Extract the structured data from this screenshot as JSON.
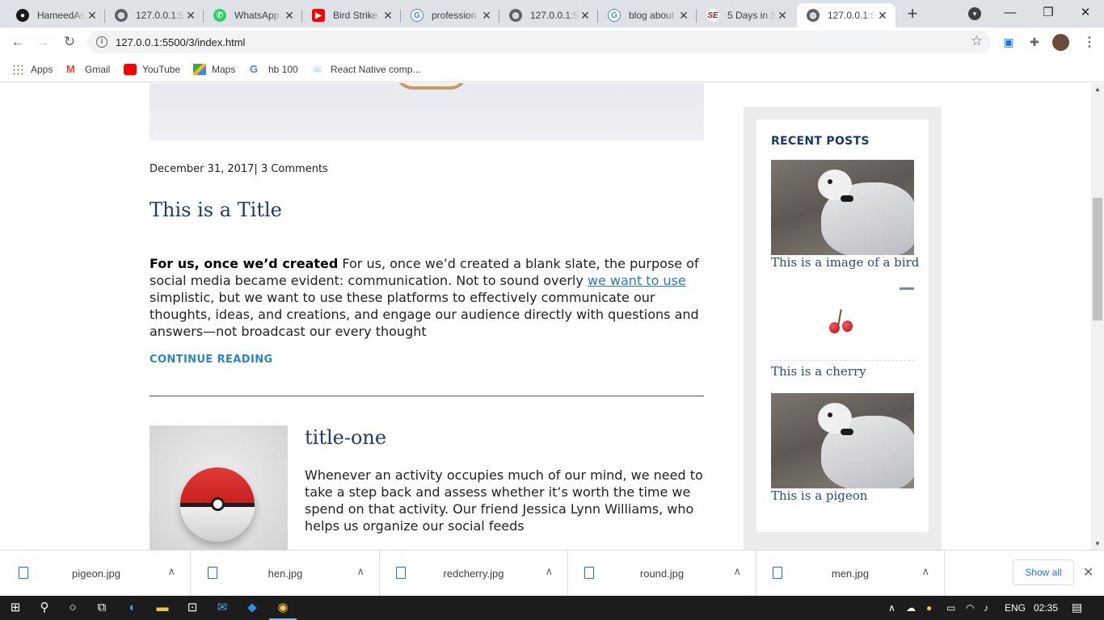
{
  "browser": {
    "tabs": [
      {
        "title": "HameedAs",
        "favicon": "github-icon",
        "color": "#181717"
      },
      {
        "title": "127.0.0.1:5",
        "favicon": "globe-icon",
        "color": "#5f6368"
      },
      {
        "title": "WhatsApp",
        "favicon": "whatsapp-icon",
        "color": "#25d366"
      },
      {
        "title": "Bird Strike",
        "favicon": "youtube-icon",
        "color": "#ff0000"
      },
      {
        "title": "profession",
        "favicon": "google-icon",
        "color": "#4285f4"
      },
      {
        "title": "127.0.0.1:5",
        "favicon": "globe-icon",
        "color": "#5f6368"
      },
      {
        "title": "blog about",
        "favicon": "google-icon",
        "color": "#4285f4"
      },
      {
        "title": "5 Days in S",
        "favicon": "site-icon",
        "color": "#a11d2a"
      },
      {
        "title": "127.0.0.1:5",
        "favicon": "globe-icon",
        "color": "#5f6368",
        "active": true
      }
    ],
    "url": "127.0.0.1:5500/3/index.html",
    "bookmarks": [
      {
        "label": "Apps",
        "icon": "apps-grid-icon"
      },
      {
        "label": "Gmail",
        "icon": "gmail-icon"
      },
      {
        "label": "YouTube",
        "icon": "youtube-icon"
      },
      {
        "label": "Maps",
        "icon": "maps-icon"
      },
      {
        "label": "hb 100",
        "icon": "google-icon"
      },
      {
        "label": "React Native comp...",
        "icon": "react-icon"
      }
    ]
  },
  "page": {
    "post": {
      "meta": "December 31, 2017| 3 Comments",
      "title": "This is a Title",
      "lead": "For us, once we’d created",
      "text_a": " For us, once we’d created a blank slate, the purpose of social media became evident: communication. Not to sound overly ",
      "link": "we want to use",
      "text_b": " simplistic, but we want to use these platforms to effectively communicate our thoughts, ideas, and creations, and engage our audience directly with questions and answers—not broadcast our every thought",
      "continue": "CONTINUE READING"
    },
    "post2": {
      "title": "title-one",
      "text": "Whenever an activity occupies much of our mind, we need to take a step back and assess whether it’s worth the time we spend on that activity. Our friend Jessica Lynn Williams, who helps us organize our social feeds"
    },
    "sidebar": {
      "heading": "RECENT POSTS",
      "items": [
        {
          "caption": "This is a image of a bird"
        },
        {
          "caption": "This is a cherry"
        },
        {
          "caption": "This is a pigeon"
        }
      ]
    }
  },
  "downloads": {
    "files": [
      "pigeon.jpg",
      "hen.jpg",
      "redcherry.jpg",
      "round.jpg",
      "men.jpg"
    ],
    "show_all": "Show all"
  },
  "taskbar": {
    "lang": "ENG",
    "time": "02:35"
  }
}
